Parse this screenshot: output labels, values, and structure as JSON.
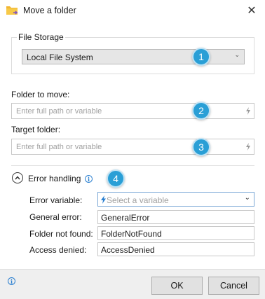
{
  "window": {
    "title": "Move a folder",
    "close_glyph": "✕"
  },
  "file_storage": {
    "legend": "File Storage",
    "selected": "Local File System",
    "chevron_glyph": "⌄"
  },
  "folder_to_move": {
    "label": "Folder to move:",
    "placeholder": "Enter full path or variable"
  },
  "target_folder": {
    "label": "Target folder:",
    "placeholder": "Enter full path or variable"
  },
  "badges": [
    "1",
    "2",
    "3",
    "4"
  ],
  "error_handling": {
    "title": "Error handling",
    "info_glyph": "i",
    "error_variable": {
      "label": "Error variable:",
      "placeholder": "Select a variable",
      "chevron_glyph": "⌄"
    },
    "general_error": {
      "label": "General error:",
      "value": "GeneralError"
    },
    "folder_not_found": {
      "label": "Folder not found:",
      "value": "FolderNotFound"
    },
    "access_denied": {
      "label": "Access denied:",
      "value": "AccessDenied"
    }
  },
  "footer": {
    "info_glyph": "i",
    "ok_label": "OK",
    "cancel_label": "Cancel"
  },
  "colors": {
    "badge": "#2a9fd6",
    "folder_icon": "#f2b632",
    "accent_blue": "#2a7fd0"
  }
}
